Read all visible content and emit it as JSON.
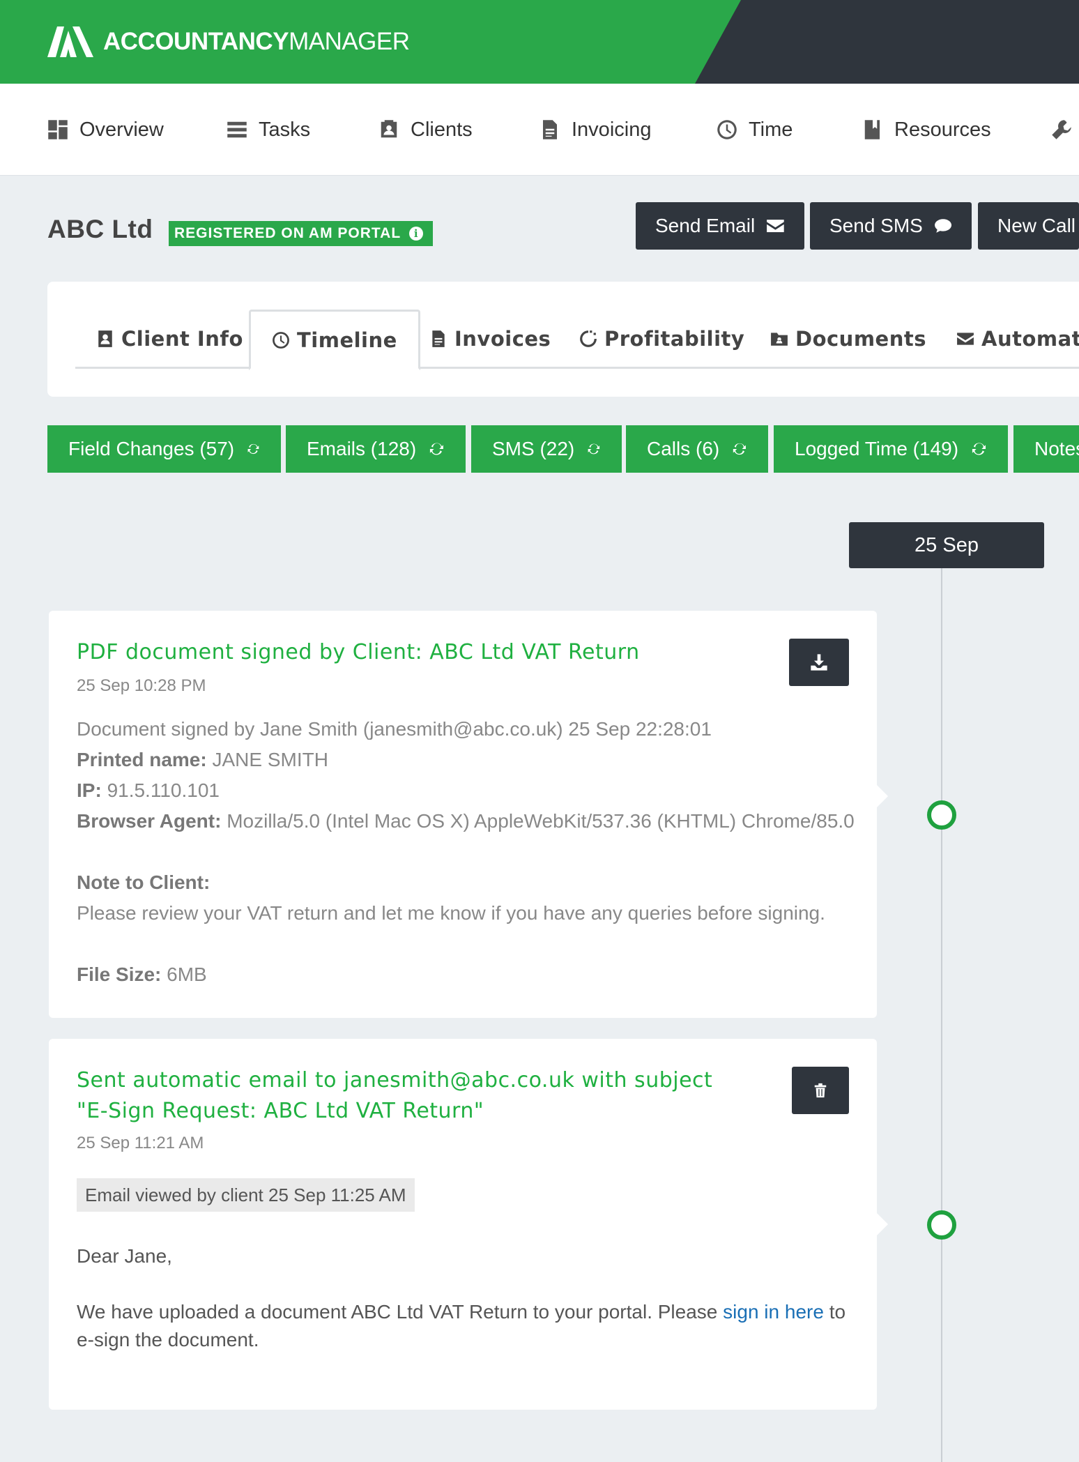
{
  "header": {
    "brand_strong": "ACCOUNTANCY",
    "brand_light": "MANAGER"
  },
  "nav": {
    "items": [
      {
        "label": "Overview",
        "icon": "dashboard-icon"
      },
      {
        "label": "Tasks",
        "icon": "list-icon"
      },
      {
        "label": "Clients",
        "icon": "contact-card-icon"
      },
      {
        "label": "Invoicing",
        "icon": "document-icon"
      },
      {
        "label": "Time",
        "icon": "clock-icon"
      },
      {
        "label": "Resources",
        "icon": "book-icon"
      },
      {
        "label": "",
        "icon": "wrench-icon"
      }
    ]
  },
  "client": {
    "name": "ABC Ltd",
    "portal_badge": "REGISTERED ON AM PORTAL"
  },
  "actions": {
    "send_email": "Send Email",
    "send_sms": "Send SMS",
    "new_call": "New Call"
  },
  "tabs": [
    {
      "label": "Client Info",
      "icon": "contact-card-icon",
      "active": false
    },
    {
      "label": "Timeline",
      "icon": "clock-icon",
      "active": true
    },
    {
      "label": "Invoices",
      "icon": "document-icon",
      "active": false
    },
    {
      "label": "Profitability",
      "icon": "refresh-circle-icon",
      "active": false
    },
    {
      "label": "Documents",
      "icon": "folder-icon",
      "active": false
    },
    {
      "label": "Automatic",
      "icon": "envelope-icon",
      "active": false
    }
  ],
  "filters": [
    {
      "label": "Field Changes (57)"
    },
    {
      "label": "Emails (128)"
    },
    {
      "label": "SMS (22)"
    },
    {
      "label": "Calls (6)"
    },
    {
      "label": "Logged Time (149)"
    },
    {
      "label": "Notes"
    }
  ],
  "timeline": {
    "date_label": "25 Sep",
    "entries": [
      {
        "title": "PDF document signed by Client: ABC Ltd VAT Return",
        "timestamp": "25 Sep 10:28 PM",
        "signed_line": "Document signed by Jane Smith (janesmith@abc.co.uk) 25 Sep 22:28:01",
        "printed_name_label": "Printed name:",
        "printed_name": "JANE SMITH",
        "ip_label": "IP:",
        "ip": "91.5.110.101",
        "browser_label": "Browser Agent:",
        "browser": "Mozilla/5.0 (Intel Mac OS X) AppleWebKit/537.36 (KHTML) Chrome/85.0",
        "note_label": "Note to Client:",
        "note": "Please review your VAT return and let me know if you have any queries before signing.",
        "file_size_label": "File Size:",
        "file_size": "6MB",
        "action_icon": "download-icon"
      },
      {
        "title_line1": "Sent automatic email to janesmith@abc.co.uk with subject",
        "title_line2": "\"E-Sign Request: ABC Ltd VAT Return\"",
        "timestamp": "25 Sep 11:21 AM",
        "viewed": "Email viewed by client 25 Sep 11:25 AM",
        "greeting": "Dear Jane,",
        "body_before": "We have uploaded a document ABC Ltd VAT Return to your portal. Please ",
        "body_link": "sign in here",
        "body_after": " to e-sign the document.",
        "action_icon": "trash-icon"
      }
    ]
  },
  "colors": {
    "brand_green": "#2aa84a",
    "dark": "#2f353d",
    "title_green": "#1fb040",
    "link_blue": "#1a6fb5"
  }
}
